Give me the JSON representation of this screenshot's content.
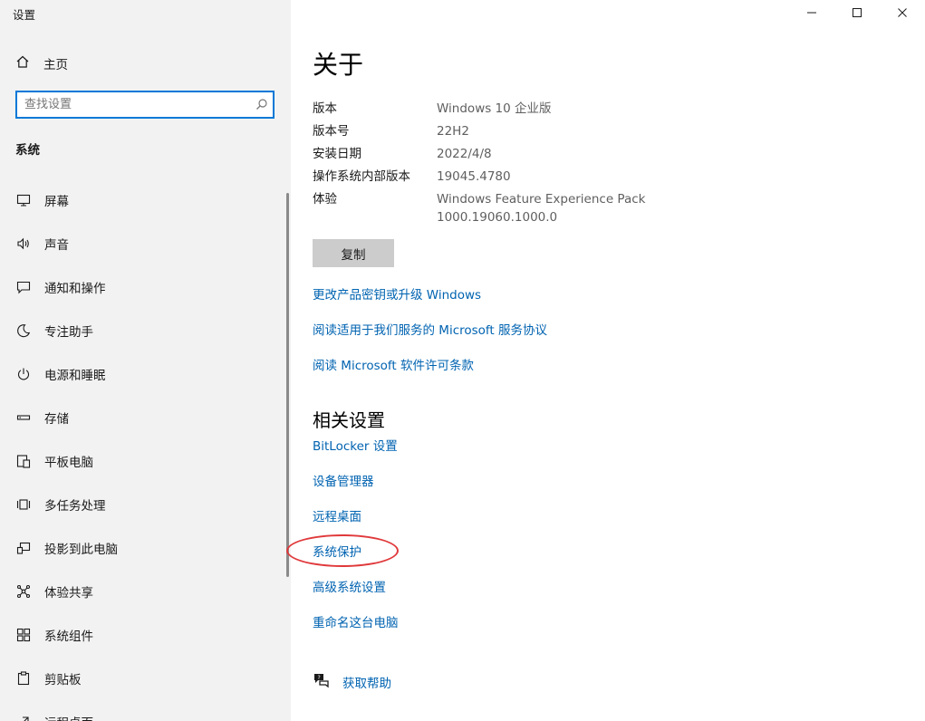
{
  "window": {
    "title": "设置",
    "controls": [
      "minimize-icon",
      "maximize-icon",
      "close-icon"
    ]
  },
  "sidebar": {
    "home_label": "主页",
    "search_placeholder": "查找设置",
    "section_label": "系统",
    "items": [
      {
        "label": "屏幕",
        "icon": "display-icon"
      },
      {
        "label": "声音",
        "icon": "speaker-icon"
      },
      {
        "label": "通知和操作",
        "icon": "notification-icon"
      },
      {
        "label": "专注助手",
        "icon": "moon-icon"
      },
      {
        "label": "电源和睡眠",
        "icon": "power-icon"
      },
      {
        "label": "存储",
        "icon": "storage-icon"
      },
      {
        "label": "平板电脑",
        "icon": "tablet-icon"
      },
      {
        "label": "多任务处理",
        "icon": "multitask-icon"
      },
      {
        "label": "投影到此电脑",
        "icon": "project-icon"
      },
      {
        "label": "体验共享",
        "icon": "share-icon"
      },
      {
        "label": "系统组件",
        "icon": "components-icon"
      },
      {
        "label": "剪贴板",
        "icon": "clipboard-icon"
      },
      {
        "label": "远程桌面",
        "icon": "remote-icon"
      }
    ]
  },
  "main": {
    "title": "关于",
    "specs": [
      {
        "key": "版本",
        "value": "Windows 10 企业版"
      },
      {
        "key": "版本号",
        "value": "22H2"
      },
      {
        "key": "安装日期",
        "value": "2022/4/8"
      },
      {
        "key": "操作系统内部版本",
        "value": "19045.4780"
      },
      {
        "key": "体验",
        "value": "Windows Feature Experience Pack",
        "value2": "1000.19060.1000.0"
      }
    ],
    "copy_label": "复制",
    "links": [
      "更改产品密钥或升级 Windows",
      "阅读适用于我们服务的 Microsoft 服务协议",
      "阅读 Microsoft 软件许可条款"
    ],
    "related_title": "相关设置",
    "related_links": [
      "BitLocker 设置",
      "设备管理器",
      "远程桌面",
      "系统保护",
      "高级系统设置",
      "重命名这台电脑"
    ],
    "help_label": "获取帮助"
  },
  "colors": {
    "accent": "#0078d7",
    "link": "#0063b1",
    "annotation": "#e0393b",
    "sidebar_bg": "#f2f2f2"
  }
}
